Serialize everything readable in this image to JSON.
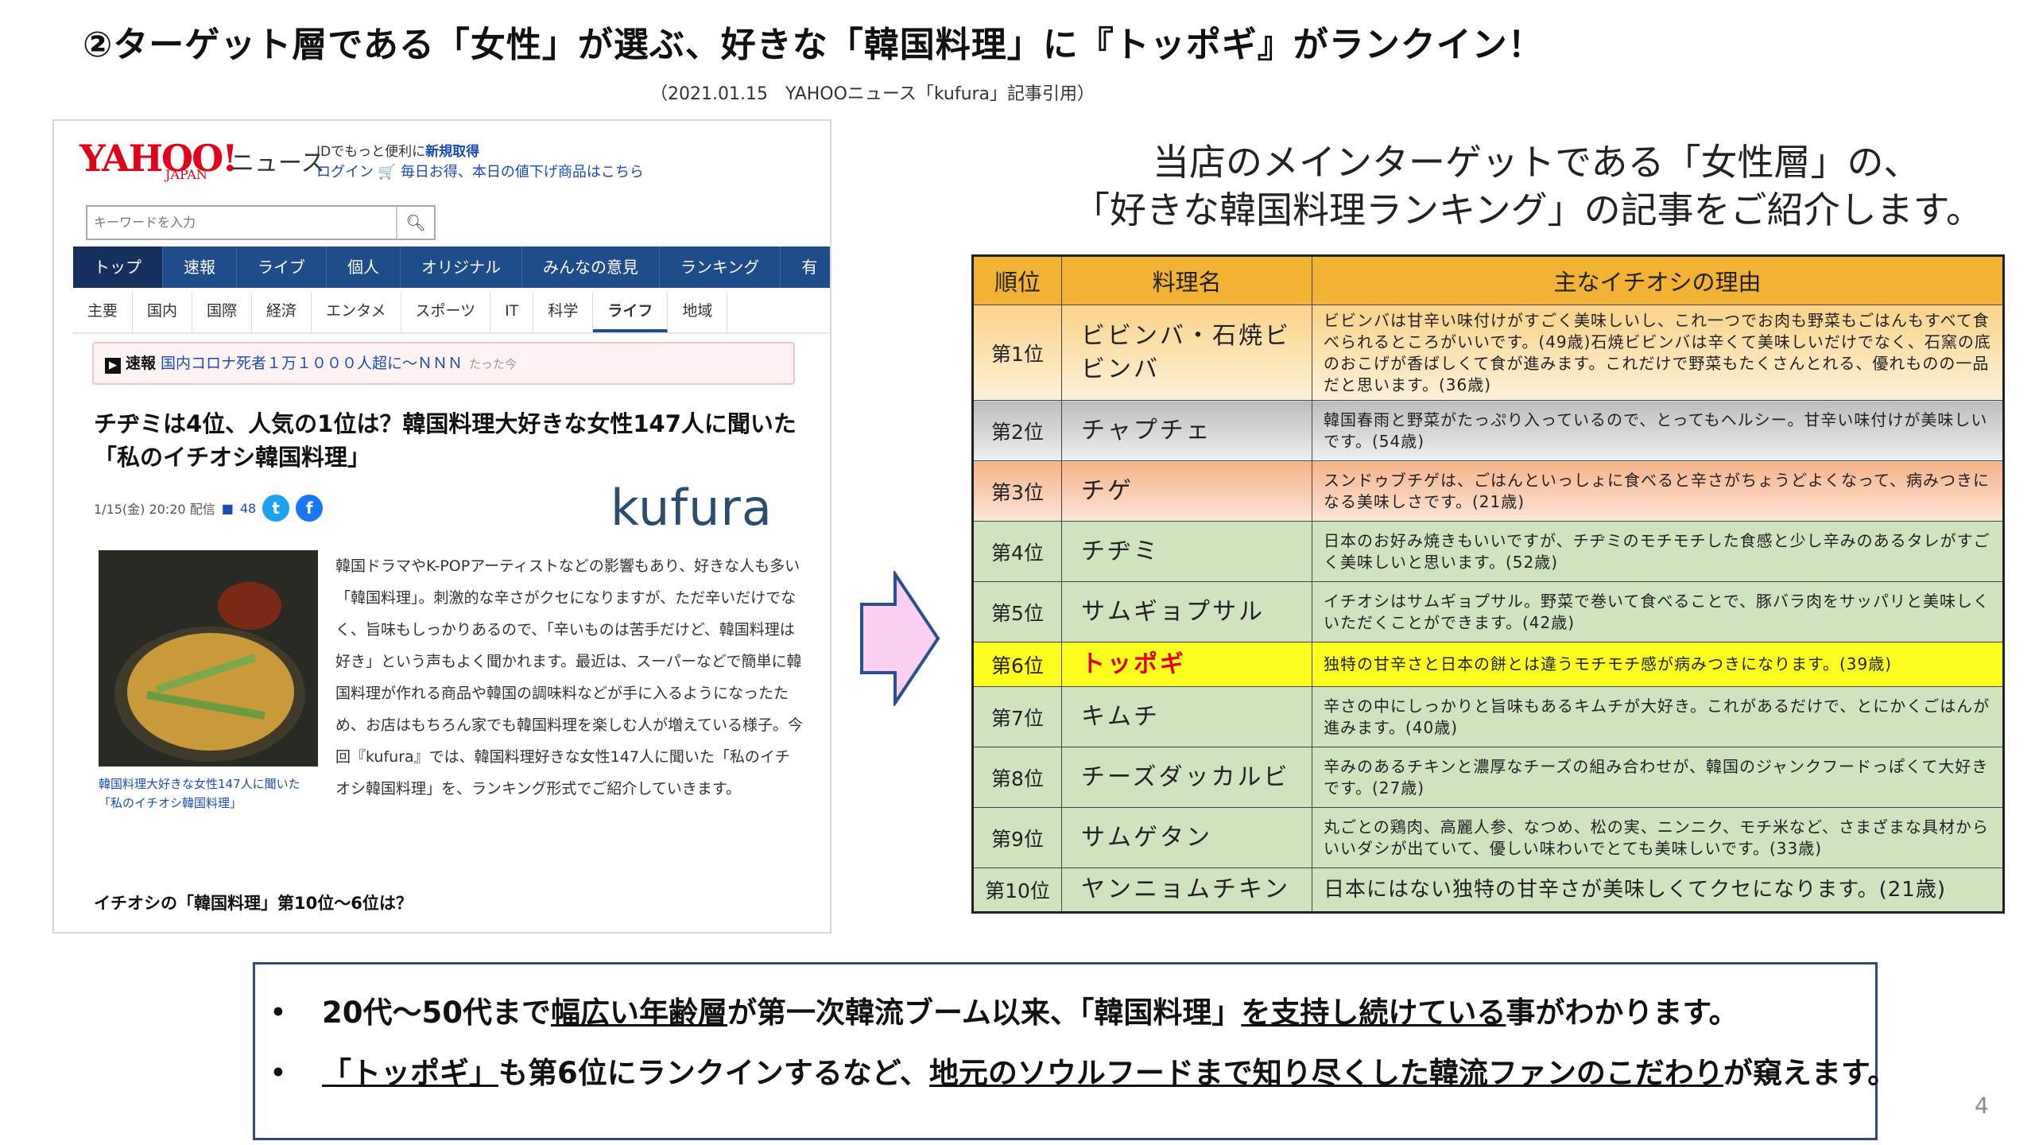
{
  "slide": {
    "title": "②ターゲット層である「女性」が選ぶ、好きな「韓国料理」に『トッポギ』がランクイン！",
    "source_note": "（2021.01.15　YAHOOニュース「kufura」記事引用）",
    "intro_line1": "当店のメインターゲットである「女性層」の、",
    "intro_line2": "「好きな韓国料理ランキング」の記事をご紹介します。",
    "page_number": "4"
  },
  "article": {
    "logo": "YAHOO!",
    "logo_sub": "JAPAN",
    "news_label": "ニュース",
    "id_prefix": "IDでもっと便利に",
    "id_link": "新規取得",
    "login": "ログイン",
    "promo": "毎日お得、本日の値下げ商品はこちら",
    "search_placeholder": "キーワードを入力",
    "nav": [
      "トップ",
      "速報",
      "ライブ",
      "個人",
      "オリジナル",
      "みんなの意見",
      "ランキング",
      "有"
    ],
    "subnav": [
      "主要",
      "国内",
      "国際",
      "経済",
      "エンタメ",
      "スポーツ",
      "IT",
      "科学",
      "ライフ",
      "地域"
    ],
    "breaking_label": "速報",
    "breaking_text": "国内コロナ死者１万１０００人超に～ＮＮＮ",
    "breaking_time": "たった今",
    "headline": "チヂミは4位、人気の1位は？韓国料理大好きな女性147人に聞いた「私のイチオシ韓国料理」",
    "date": "1/15(金) 20:20 配信",
    "comments": "48",
    "brand": "kufura",
    "photo_caption": "韓国料理大好きな女性147人に聞いた「私のイチオシ韓国料理」",
    "body": "韓国ドラマやK-POPアーティストなどの影響もあり、好きな人も多い「韓国料理」。刺激的な辛さがクセになりますが、ただ辛いだけでなく、旨味もしっかりあるので、「辛いものは苦手だけど、韓国料理は好き」という声もよく聞かれます。最近は、スーパーなどで簡単に韓国料理が作れる商品や韓国の調味料などが手に入るようになったため、お店はもちろん家でも韓国料理を楽しむ人が増えている様子。今回『kufura』では、韓国料理好きな女性147人に聞いた「私のイチオシ韓国料理」を、ランキング形式でご紹介していきます。",
    "subhead": "イチオシの「韓国料理」第10位～6位は？"
  },
  "ranking": {
    "headers": [
      "順位",
      "料理名",
      "主なイチオシの理由"
    ],
    "rows": [
      {
        "rank": "第1位",
        "dish": "ビビンバ・石焼ビビンバ",
        "reason": "ビビンバは甘辛い味付けがすごく美味しいし、これ一つでお肉も野菜もごはんもすべて食べられるところがいいです。(49歳)石焼ビビンバは辛くて美味しいだけでなく、石窯の底のおこげが香ばしくて食が進みます。これだけで野菜もたくさんとれる、優れものの一品だと思います。(36歳)"
      },
      {
        "rank": "第2位",
        "dish": "チャプチェ",
        "reason": "韓国春雨と野菜がたっぷり入っているので、とってもヘルシー。甘辛い味付けが美味しいです。(54歳)"
      },
      {
        "rank": "第3位",
        "dish": "チゲ",
        "reason": "スンドゥブチゲは、ごはんといっしょに食べると辛さがちょうどよくなって、病みつきになる美味しさです。(21歳)"
      },
      {
        "rank": "第4位",
        "dish": "チヂミ",
        "reason": "日本のお好み焼きもいいですが、チヂミのモチモチした食感と少し辛みのあるタレがすごく美味しいと思います。(52歳)"
      },
      {
        "rank": "第5位",
        "dish": "サムギョプサル",
        "reason": "イチオシはサムギョプサル。野菜で巻いて食べることで、豚バラ肉をサッパリと美味しくいただくことができます。(42歳)"
      },
      {
        "rank": "第6位",
        "dish": "トッポギ",
        "reason": "独特の甘辛さと日本の餅とは違うモチモチ感が病みつきになります。(39歳)"
      },
      {
        "rank": "第7位",
        "dish": "キムチ",
        "reason": "辛さの中にしっかりと旨味もあるキムチが大好き。これがあるだけで、とにかくごはんが進みます。(40歳)"
      },
      {
        "rank": "第8位",
        "dish": "チーズダッカルビ",
        "reason": "辛みのあるチキンと濃厚なチーズの組み合わせが、韓国のジャンクフードっぽくて大好きです。(27歳)"
      },
      {
        "rank": "第9位",
        "dish": "サムゲタン",
        "reason": "丸ごとの鶏肉、高麗人参、なつめ、松の実、ニンニク、モチ米など、さまざまな具材からいいダシが出ていて、優しい味わいでとても美味しいです。(33歳)"
      },
      {
        "rank": "第10位",
        "dish": "ヤンニョムチキン",
        "reason": "日本にはない独特の甘辛さが美味しくてクセになります。(21歳)"
      }
    ]
  },
  "summary": {
    "bullet": "•",
    "p1_a": "20代～50代まで",
    "p1_b": "幅広い年齢層",
    "p1_c": "が第一次韓流ブーム以来、「韓国料理」",
    "p1_d": "を支持し続けている",
    "p1_e": "事がわかります。",
    "p2_a": "「トッポギ」",
    "p2_b": "も第6位にランクインするなど、",
    "p2_c": "地元のソウルフードまで知り尽くした韓流ファンのこだわり",
    "p2_d": "が窺えます。"
  }
}
